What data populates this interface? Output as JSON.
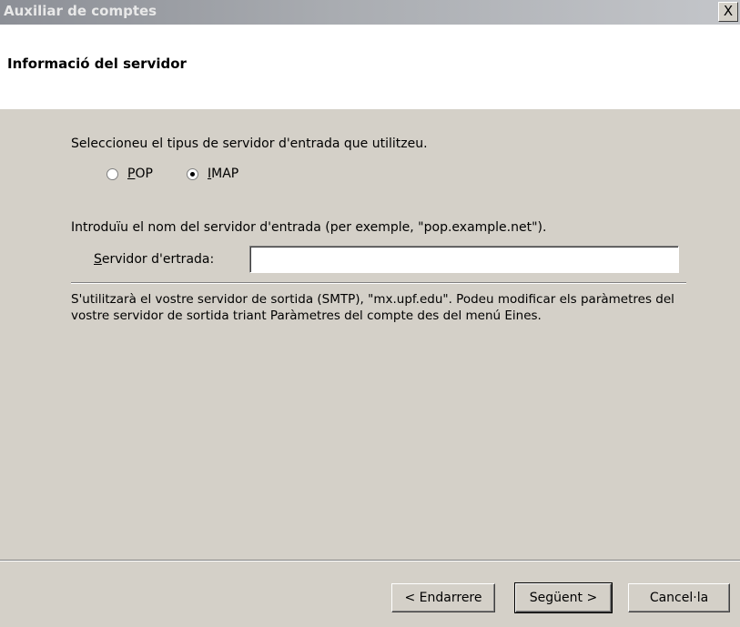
{
  "window": {
    "title": "Auxiliar de comptes",
    "close_label": "X"
  },
  "header": {
    "title": "Informació del servidor"
  },
  "server_type": {
    "prompt": "Seleccioneu el tipus de servidor d'entrada que utilitzeu.",
    "options": [
      {
        "accesskey": "P",
        "rest": "OP",
        "checked": false
      },
      {
        "accesskey": "I",
        "rest": "MAP",
        "checked": true
      }
    ]
  },
  "incoming": {
    "prompt": "Introduïu el nom del servidor d'entrada (per exemple, \"pop.example.net\").",
    "label_accesskey": "S",
    "label_rest": "ervidor d'ertrada:",
    "value": ""
  },
  "info_text": "S'utilitzarà el vostre servidor de sortida (SMTP), \"mx.upf.edu\". Podeu modificar els paràmetres del vostre servidor de sortida triant Paràmetres del compte des del menú Eines.",
  "buttons": {
    "back": "< Endarrere",
    "next": "Següent >",
    "cancel": "Cancel·la"
  }
}
